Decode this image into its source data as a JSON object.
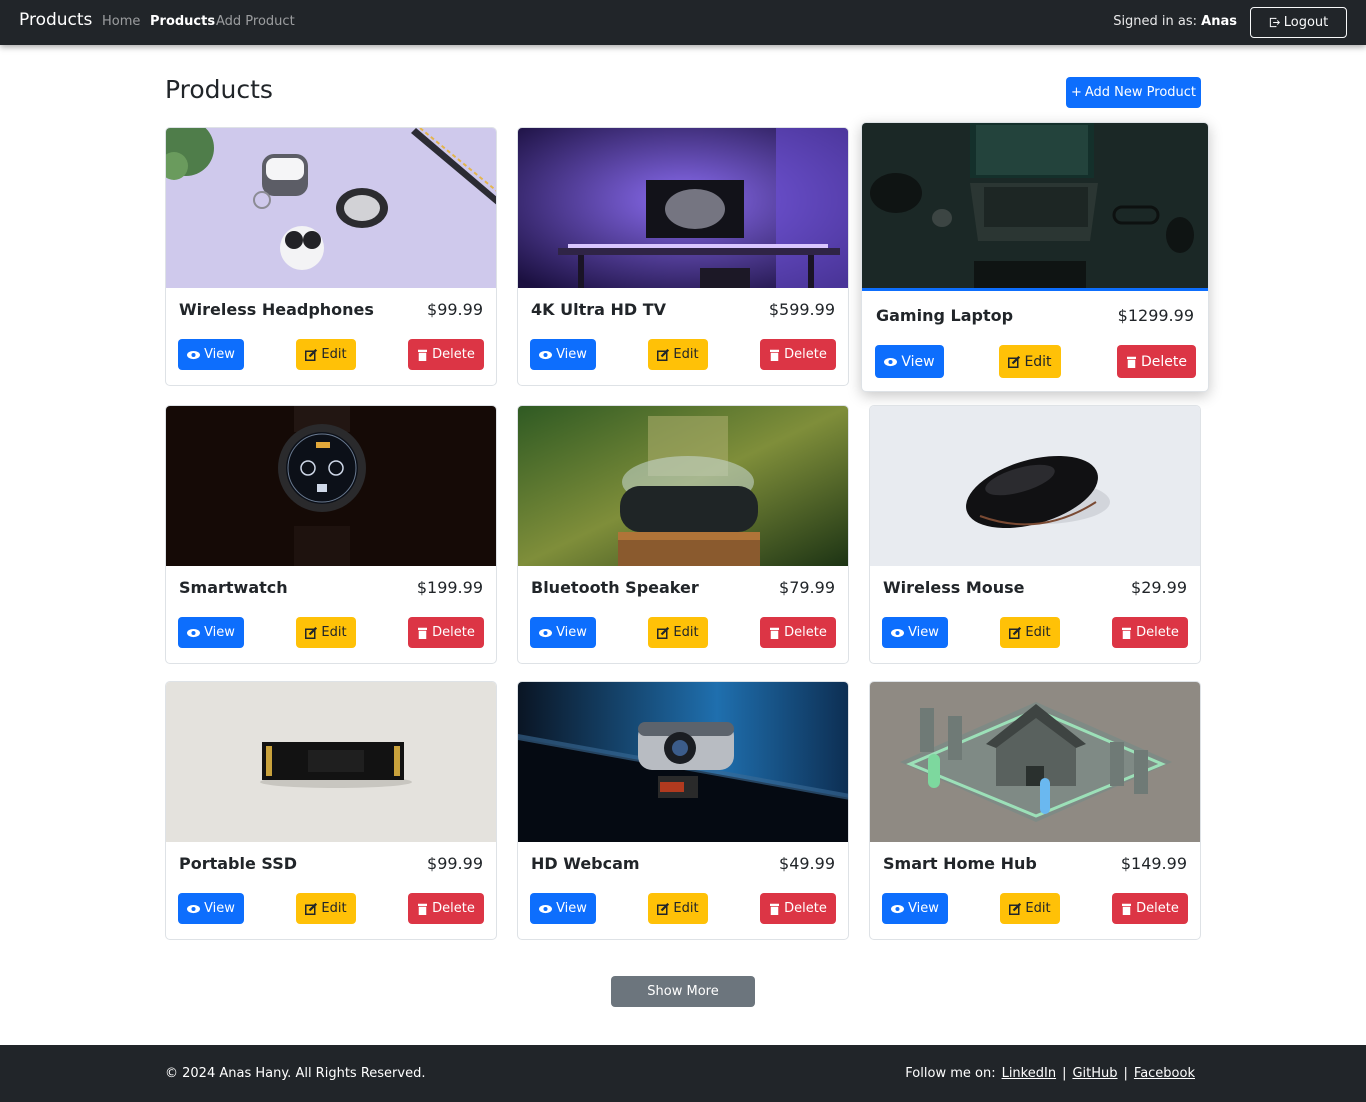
{
  "navbar": {
    "brand": "Products",
    "links": [
      "Home",
      "Products",
      "Add Product"
    ],
    "signed_in_label": "Signed in as:",
    "user": "Anas",
    "logout": "Logout"
  },
  "header": {
    "title": "Products",
    "add_button": "Add New Product"
  },
  "buttons": {
    "view": "View",
    "edit": "Edit",
    "delete": "Delete"
  },
  "products": [
    {
      "name": "Wireless Headphones",
      "price": "$99.99"
    },
    {
      "name": "4K Ultra HD TV",
      "price": "$599.99"
    },
    {
      "name": "Gaming Laptop",
      "price": "$1299.99"
    },
    {
      "name": "Smartwatch",
      "price": "$199.99"
    },
    {
      "name": "Bluetooth Speaker",
      "price": "$79.99"
    },
    {
      "name": "Wireless Mouse",
      "price": "$29.99"
    },
    {
      "name": "Portable SSD",
      "price": "$99.99"
    },
    {
      "name": "HD Webcam",
      "price": "$49.99"
    },
    {
      "name": "Smart Home Hub",
      "price": "$149.99"
    }
  ],
  "show_more": "Show More",
  "footer": {
    "copyright": "© 2024 Anas Hany. All Rights Reserved.",
    "follow_label": "Follow me on:",
    "links": [
      "LinkedIn",
      "GitHub",
      "Facebook"
    ],
    "separator": "|"
  },
  "colors": {
    "primary": "#0d6efd",
    "warning": "#ffc107",
    "danger": "#dc3545",
    "secondary": "#6c757d",
    "dark": "#212529"
  }
}
